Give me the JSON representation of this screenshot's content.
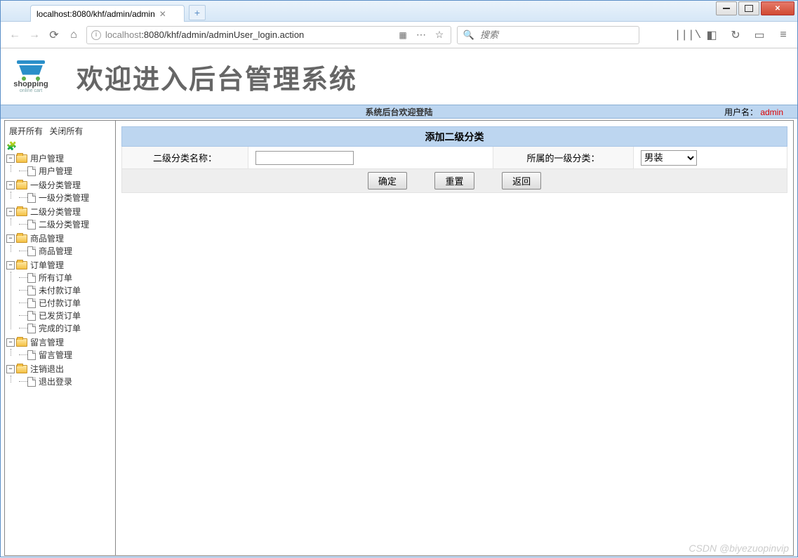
{
  "browser": {
    "tab_title": "localhost:8080/khf/admin/admin",
    "url_gray_prefix": "localhost",
    "url_rest": ":8080/khf/admin/adminUser_login.action",
    "search_placeholder": "搜索"
  },
  "banner": {
    "logo_text": "shopping",
    "logo_sub": "online cart",
    "welcome_text": "欢迎进入后台管理系统"
  },
  "sysbar": {
    "center_text": "系统后台欢迎登陆",
    "user_label": "用户名：",
    "user_name": "admin"
  },
  "sidebar": {
    "expand_all": "展开所有",
    "collapse_all": "关闭所有",
    "nodes": [
      {
        "label": "用户管理",
        "children": [
          "用户管理"
        ]
      },
      {
        "label": "一级分类管理",
        "children": [
          "一级分类管理"
        ]
      },
      {
        "label": "二级分类管理",
        "children": [
          "二级分类管理"
        ]
      },
      {
        "label": "商品管理",
        "children": [
          "商品管理"
        ]
      },
      {
        "label": "订单管理",
        "children": [
          "所有订单",
          "未付款订单",
          "已付款订单",
          "已发货订单",
          "完成的订单"
        ]
      },
      {
        "label": "留言管理",
        "children": [
          "留言管理"
        ]
      },
      {
        "label": "注销退出",
        "children": [
          "退出登录"
        ]
      }
    ]
  },
  "form": {
    "title": "添加二级分类",
    "name_label": "二级分类名称：",
    "name_value": "",
    "parent_label": "所属的一级分类：",
    "parent_selected": "男装",
    "submit": "确定",
    "reset": "重置",
    "back": "返回"
  },
  "watermark": "CSDN @biyezuopinvip"
}
